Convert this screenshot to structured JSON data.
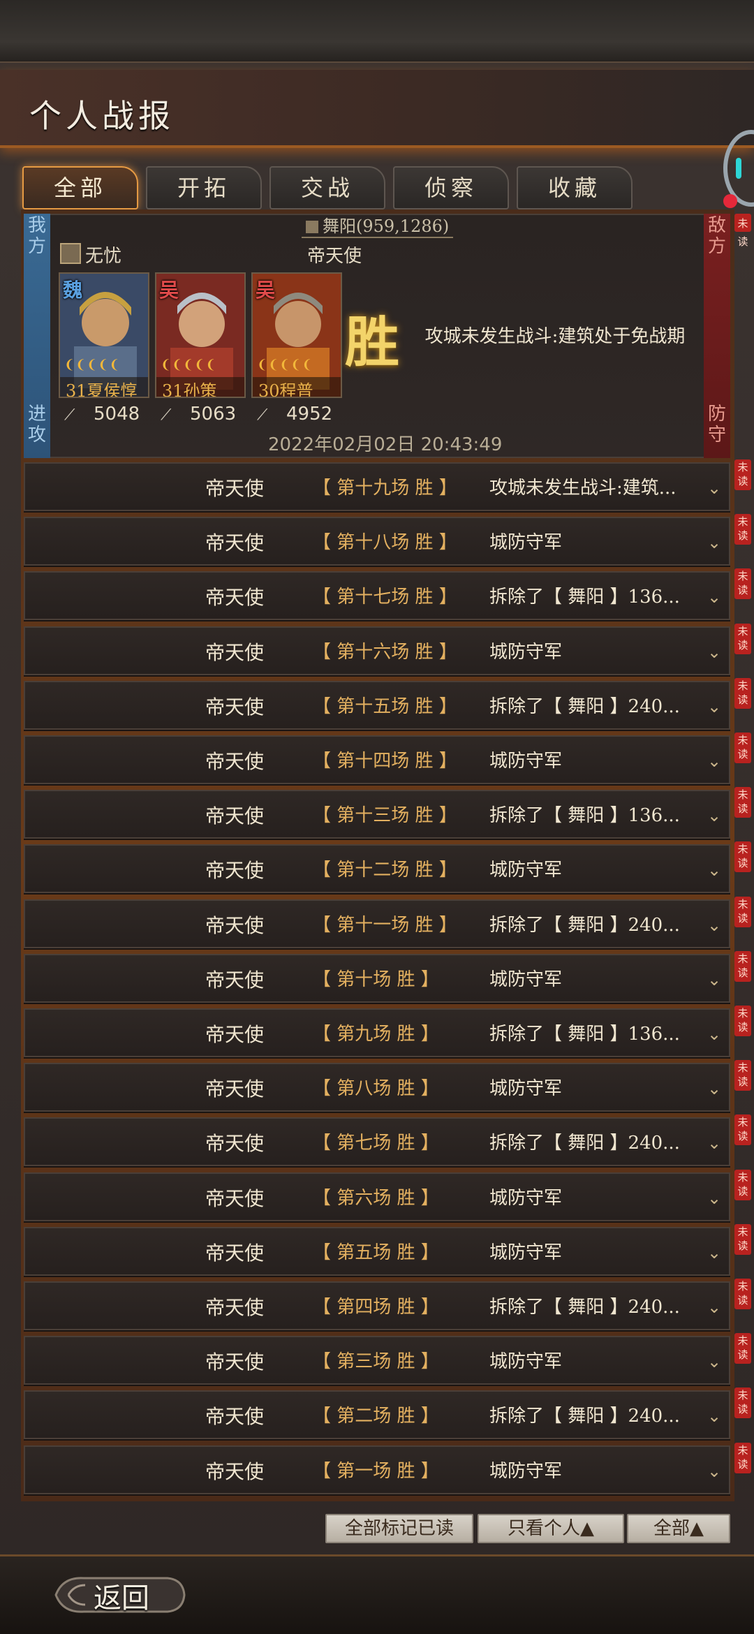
{
  "title": "个人战报",
  "tabs": [
    {
      "label": "全部",
      "active": true
    },
    {
      "label": "开拓",
      "active": false
    },
    {
      "label": "交战",
      "active": false
    },
    {
      "label": "侦察",
      "active": false
    },
    {
      "label": "收藏",
      "active": false
    }
  ],
  "detail": {
    "left_side": "我方",
    "left_side_bottom": "进攻",
    "right_side": "敌方",
    "right_side_bottom": "防守",
    "location": "舞阳(959,1286)",
    "ally_name": "无忧",
    "commander": "帝天使",
    "heroes": [
      {
        "faction": "魏",
        "faction_color": "#5aa0e0",
        "stars": "❨❨❨❨❨",
        "level_name": "31夏侯惇",
        "troops": "5048"
      },
      {
        "faction": "吴",
        "faction_color": "#e04a4a",
        "stars": "❨❨❨❨❨",
        "level_name": "31孙策",
        "troops": "5063"
      },
      {
        "faction": "吴",
        "faction_color": "#e04a4a",
        "stars": "❨❨❨❨❨",
        "level_name": "30程普",
        "troops": "4952"
      }
    ],
    "victory": "胜",
    "result_text": "攻城未发生战斗:建筑处于免战期",
    "time": "2022年02月02日 20:43:49"
  },
  "rows": [
    {
      "player": "帝天使",
      "round": "【 第十九场 胜 】",
      "result": "攻城未发生战斗:建筑...",
      "unread": "未读"
    },
    {
      "player": "帝天使",
      "round": "【 第十八场 胜 】",
      "result": "城防守军",
      "unread": "未读"
    },
    {
      "player": "帝天使",
      "round": "【 第十七场 胜 】",
      "result": "拆除了【 舞阳 】136...",
      "unread": "未读"
    },
    {
      "player": "帝天使",
      "round": "【 第十六场 胜 】",
      "result": "城防守军",
      "unread": "未读"
    },
    {
      "player": "帝天使",
      "round": "【 第十五场 胜 】",
      "result": "拆除了【 舞阳 】240...",
      "unread": "未读"
    },
    {
      "player": "帝天使",
      "round": "【 第十四场 胜 】",
      "result": "城防守军",
      "unread": "未读"
    },
    {
      "player": "帝天使",
      "round": "【 第十三场 胜 】",
      "result": "拆除了【 舞阳 】136...",
      "unread": "未读"
    },
    {
      "player": "帝天使",
      "round": "【 第十二场 胜 】",
      "result": "城防守军",
      "unread": "未读"
    },
    {
      "player": "帝天使",
      "round": "【 第十一场 胜 】",
      "result": "拆除了【 舞阳 】240...",
      "unread": "未读"
    },
    {
      "player": "帝天使",
      "round": "【 第十场 胜 】",
      "result": "城防守军",
      "unread": "未读"
    },
    {
      "player": "帝天使",
      "round": "【 第九场 胜 】",
      "result": "拆除了【 舞阳 】136...",
      "unread": "未读"
    },
    {
      "player": "帝天使",
      "round": "【 第八场 胜 】",
      "result": "城防守军",
      "unread": "未读"
    },
    {
      "player": "帝天使",
      "round": "【 第七场 胜 】",
      "result": "拆除了【 舞阳 】240...",
      "unread": "未读"
    },
    {
      "player": "帝天使",
      "round": "【 第六场 胜 】",
      "result": "城防守军",
      "unread": "未读"
    },
    {
      "player": "帝天使",
      "round": "【 第五场 胜 】",
      "result": "城防守军",
      "unread": "未读"
    },
    {
      "player": "帝天使",
      "round": "【 第四场 胜 】",
      "result": "拆除了【 舞阳 】240...",
      "unread": "未读"
    },
    {
      "player": "帝天使",
      "round": "【 第三场 胜 】",
      "result": "城防守军",
      "unread": "未读"
    },
    {
      "player": "帝天使",
      "round": "【 第二场 胜 】",
      "result": "拆除了【 舞阳 】240...",
      "unread": "未读"
    },
    {
      "player": "帝天使",
      "round": "【 第一场 胜 】",
      "result": "城防守军",
      "unread": "未读"
    }
  ],
  "top_unread": "未读",
  "bottom_buttons": {
    "mark_all_read": "全部标记已读",
    "only_personal": "只看个人▲",
    "all": "全部▲"
  },
  "back_label": "返回"
}
